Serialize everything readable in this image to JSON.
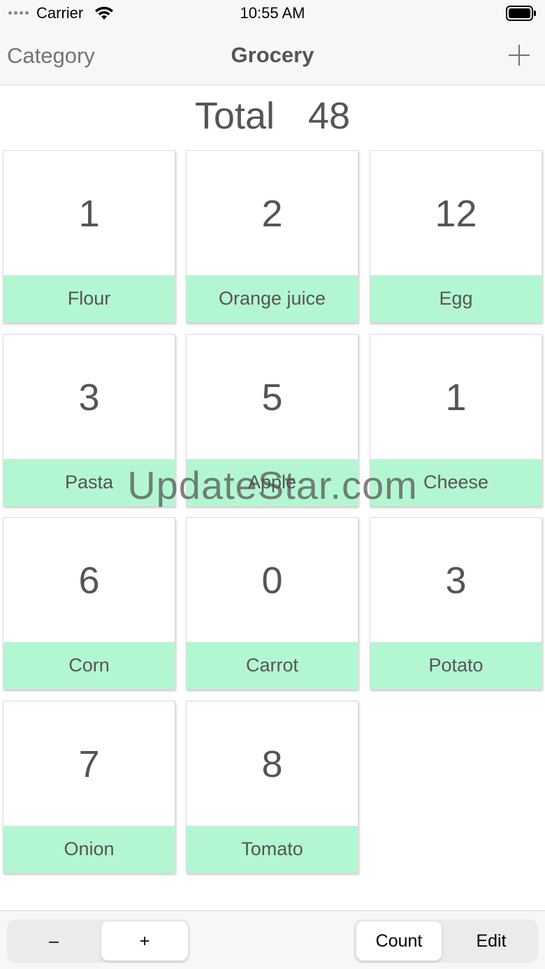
{
  "status_bar": {
    "carrier": "Carrier",
    "time": "10:55 AM",
    "icons": [
      "signal-dots-icon",
      "wifi-icon",
      "battery-icon"
    ]
  },
  "nav": {
    "left_label": "Category",
    "title": "Grocery",
    "add_icon": "plus-icon"
  },
  "total": {
    "label": "Total",
    "value": "48"
  },
  "items": [
    {
      "count": "1",
      "name": "Flour"
    },
    {
      "count": "2",
      "name": "Orange juice"
    },
    {
      "count": "12",
      "name": "Egg"
    },
    {
      "count": "3",
      "name": "Pasta"
    },
    {
      "count": "5",
      "name": "Apple"
    },
    {
      "count": "1",
      "name": "Cheese"
    },
    {
      "count": "6",
      "name": "Corn"
    },
    {
      "count": "0",
      "name": "Carrot"
    },
    {
      "count": "3",
      "name": "Potato"
    },
    {
      "count": "7",
      "name": "Onion"
    },
    {
      "count": "8",
      "name": "Tomato"
    }
  ],
  "watermark": "UpdateStar.com",
  "toolbar": {
    "step_segment": {
      "minus": "–",
      "plus": "+",
      "selected": "+"
    },
    "mode_segment": {
      "count": "Count",
      "edit": "Edit",
      "selected": "Count"
    }
  },
  "colors": {
    "label_background": "#b3f7d2",
    "text": "#555555",
    "bar_background": "#f7f7f7"
  }
}
